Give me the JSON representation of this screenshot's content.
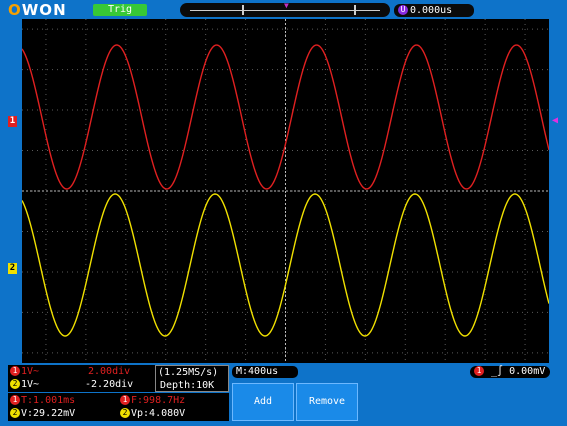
{
  "header": {
    "logo": "OWON",
    "trigger_status": "Trig",
    "horizontal_position": "0.000us"
  },
  "channels": {
    "ch1": {
      "label": "1",
      "coupling": "1V~",
      "offset": "2.00div",
      "color": "#e02020"
    },
    "ch2": {
      "label": "2",
      "coupling": "1V~",
      "offset": "-2.20div",
      "color": "#f0e000"
    }
  },
  "acquisition": {
    "sample_rate": "(1.25MS/s)",
    "depth": "Depth:10K",
    "timebase": "M:400us"
  },
  "trigger": {
    "source": "1",
    "level": "0.00mV",
    "slope_icon": "rising-edge-icon",
    "marker_color": "#e030e0"
  },
  "measurements": {
    "ch1_period": "T:1.001ms",
    "ch1_frequency": "F:998.7Hz",
    "ch2_voltage": "V:29.22mV",
    "ch2_vp": "Vp:4.080V"
  },
  "menu": {
    "add_label": "Add",
    "remove_label": "Remove"
  },
  "waveforms": {
    "frequency_hz": 998.7,
    "timebase_per_div": "400us",
    "ch1_volts_per_div": 1,
    "ch2_volts_per_div": 1
  }
}
